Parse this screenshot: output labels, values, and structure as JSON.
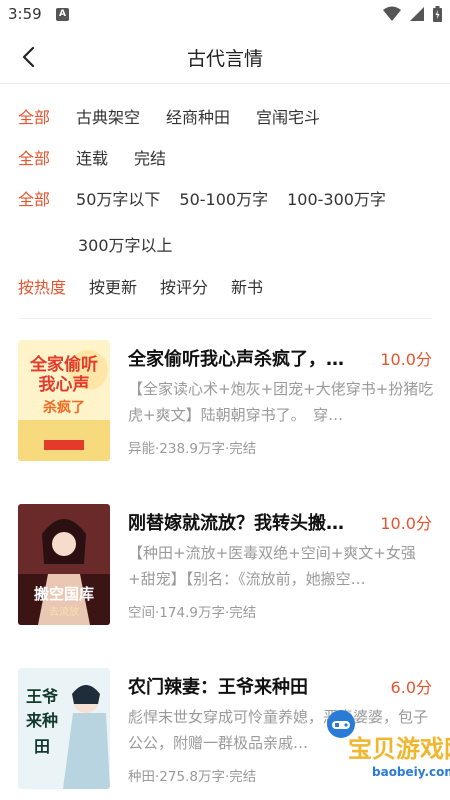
{
  "status": {
    "time": "3:59",
    "app_icon": "A"
  },
  "header": {
    "title": "古代言情",
    "back_icon": "chevron-left-icon"
  },
  "filters": {
    "category": [
      "全部",
      "古典架空",
      "经商种田",
      "宫闱宅斗"
    ],
    "status": [
      "全部",
      "连载",
      "完结"
    ],
    "word_count_row1": [
      "全部",
      "50万字以下",
      "50-100万字",
      "100-300万字"
    ],
    "word_count_row2": [
      "300万字以上"
    ],
    "sort": [
      "按热度",
      "按更新",
      "按评分",
      "新书"
    ]
  },
  "books": [
    {
      "title": "全家偷听我心声杀疯了，…",
      "score": "10.0分",
      "desc": "【全家读心术+炮灰+团宠+大佬穿书+扮猪吃虎+爽文】陆朝朝穿书了。　穿…",
      "meta": "异能·238.9万字·完结",
      "cover_text": "全家偷听我心声杀疯了"
    },
    {
      "title": "刚替嫁就流放？我转头搬…",
      "score": "10.0分",
      "desc": "【种田+流放+医毒双绝+空间+爽文+女强+甜宠】【别名：《流放前，她搬空…",
      "meta": "空间·174.9万字·完结",
      "cover_text": "搬空国库去流放"
    },
    {
      "title": "农门辣妻：王爷来种田",
      "score": "6.0分",
      "desc": "彪悍末世女穿成可怜童养媳，恶毒婆婆，包子公公，附赠一群极品亲戚…",
      "meta": "种田·275.8万字·完结",
      "cover_text": "王爷来种田"
    }
  ],
  "watermark": {
    "text": "宝贝游戏网",
    "url": "baobeiy.com"
  },
  "colors": {
    "accent": "#e8542d",
    "muted": "#9a9a9a"
  }
}
